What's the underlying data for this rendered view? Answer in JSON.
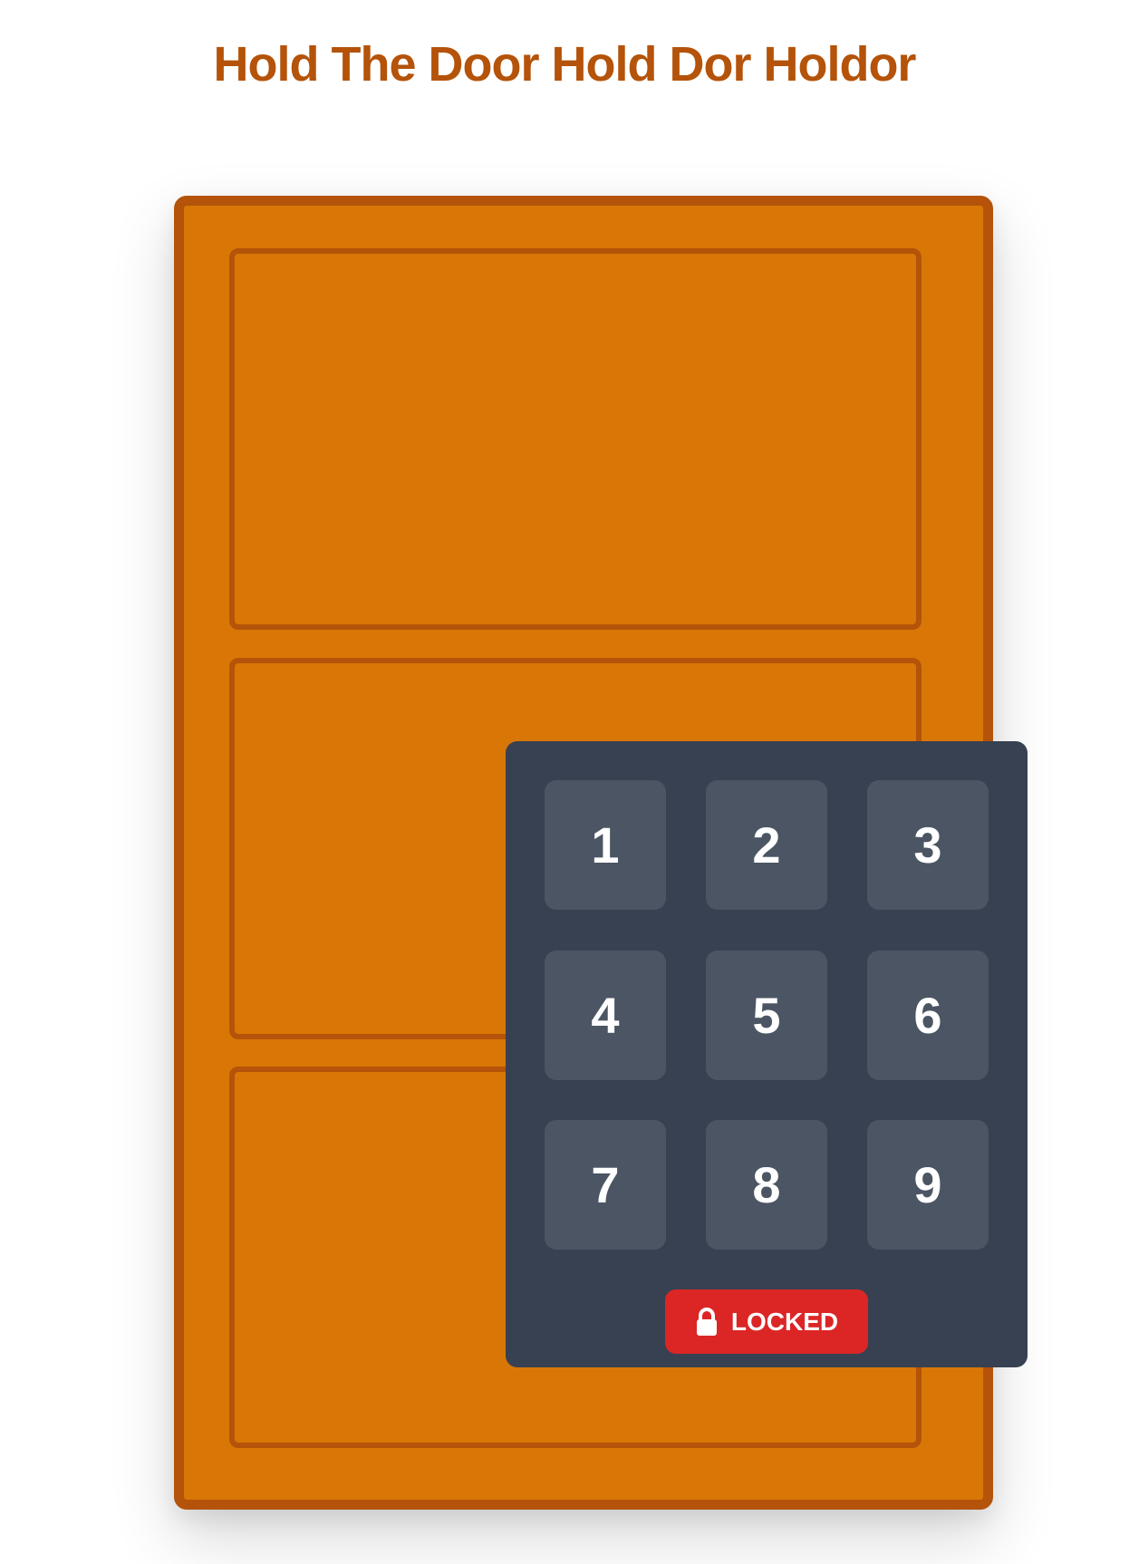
{
  "header": {
    "title": "Hold The Door Hold Dor Holdor"
  },
  "keypad": {
    "keys": [
      "1",
      "2",
      "3",
      "4",
      "5",
      "6",
      "7",
      "8",
      "9"
    ],
    "status_label": "LOCKED",
    "status_icon": "lock-icon"
  },
  "colors": {
    "door": "#d97706",
    "door_border": "#b45309",
    "handle": "#f59e0b",
    "keypad": "#374151",
    "key": "#4b5563",
    "locked": "#dc2626",
    "title": "#b45309"
  }
}
